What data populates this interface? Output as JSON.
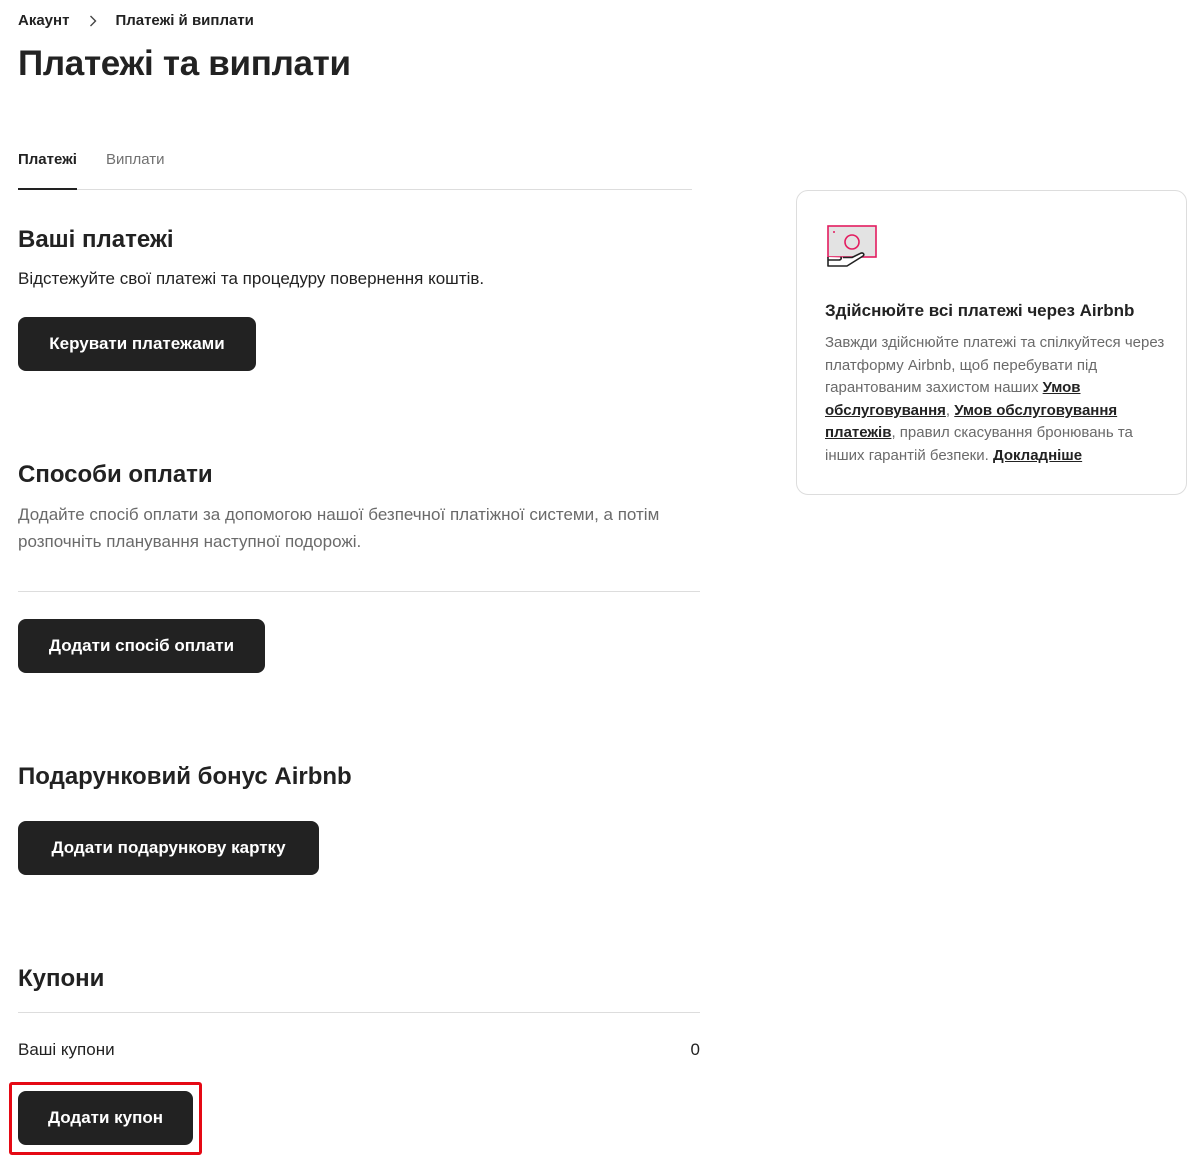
{
  "breadcrumb": {
    "account": "Акаунт",
    "current": "Платежі й виплати"
  },
  "page": {
    "title": "Платежі та виплати"
  },
  "tabs": [
    {
      "label": "Платежі",
      "active": true
    },
    {
      "label": "Виплати",
      "active": false
    }
  ],
  "payments": {
    "title": "Ваші платежі",
    "description": "Відстежуйте свої платежі та процедуру повернення коштів.",
    "button": "Керувати платежами"
  },
  "methods": {
    "title": "Способи оплати",
    "description": "Додайте спосіб оплати за допомогою нашої безпечної платіжної системи, а потім розпочніть планування наступної подорожі.",
    "button": "Додати спосіб оплати"
  },
  "gift": {
    "title": "Подарунковий бонус Airbnb",
    "button": "Додати подарункову картку"
  },
  "coupons": {
    "title": "Купони",
    "label": "Ваші купони",
    "count": "0",
    "button": "Додати купон"
  },
  "info_card": {
    "icon": "payment-protection-icon",
    "title": "Здійснюйте всі платежі через Airbnb",
    "text_1": "Завжди здійснюйте платежі та спілкуйтеся через платформу Airbnb, щоб перебувати під гарантованим захистом наших ",
    "link_terms": "Умов обслуговування",
    "text_2": ", ",
    "link_payment_terms": "Умов обслуговування платежів",
    "text_3": ", правил скасування бронювань та інших гарантій безпеки. ",
    "link_more": "Докладніше"
  },
  "colors": {
    "button_bg": "#222222",
    "highlight": "#e50914",
    "icon_accent": "#e31c5f"
  }
}
